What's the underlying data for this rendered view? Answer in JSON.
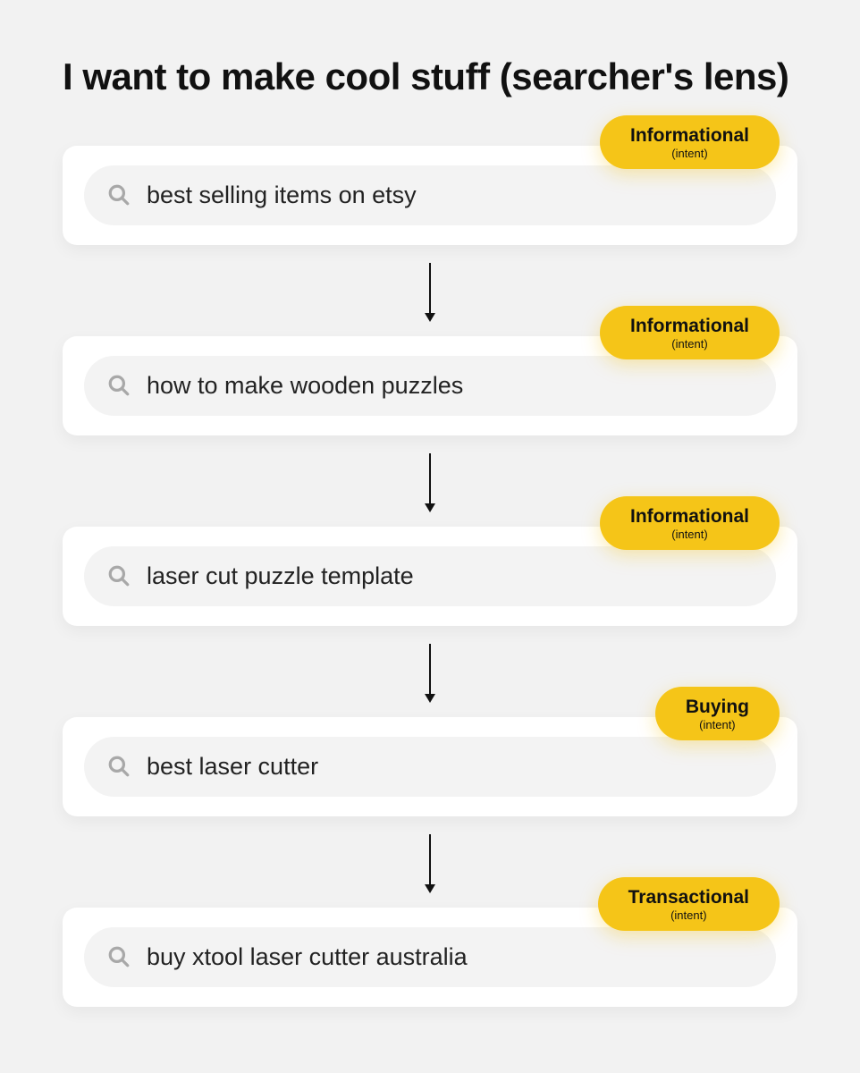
{
  "title": "I want to make cool stuff (searcher's lens)",
  "intentSub": "(intent)",
  "steps": [
    {
      "query": "best selling items on etsy",
      "intent": "Informational"
    },
    {
      "query": "how to make wooden puzzles",
      "intent": "Informational"
    },
    {
      "query": "laser cut puzzle template",
      "intent": "Informational"
    },
    {
      "query": "best laser cutter",
      "intent": "Buying"
    },
    {
      "query": "buy xtool laser cutter australia",
      "intent": "Transactional"
    }
  ],
  "colors": {
    "background": "#f2f2f2",
    "card": "#ffffff",
    "searchbar": "#f3f3f3",
    "badge": "#f5c518",
    "text": "#222222"
  }
}
